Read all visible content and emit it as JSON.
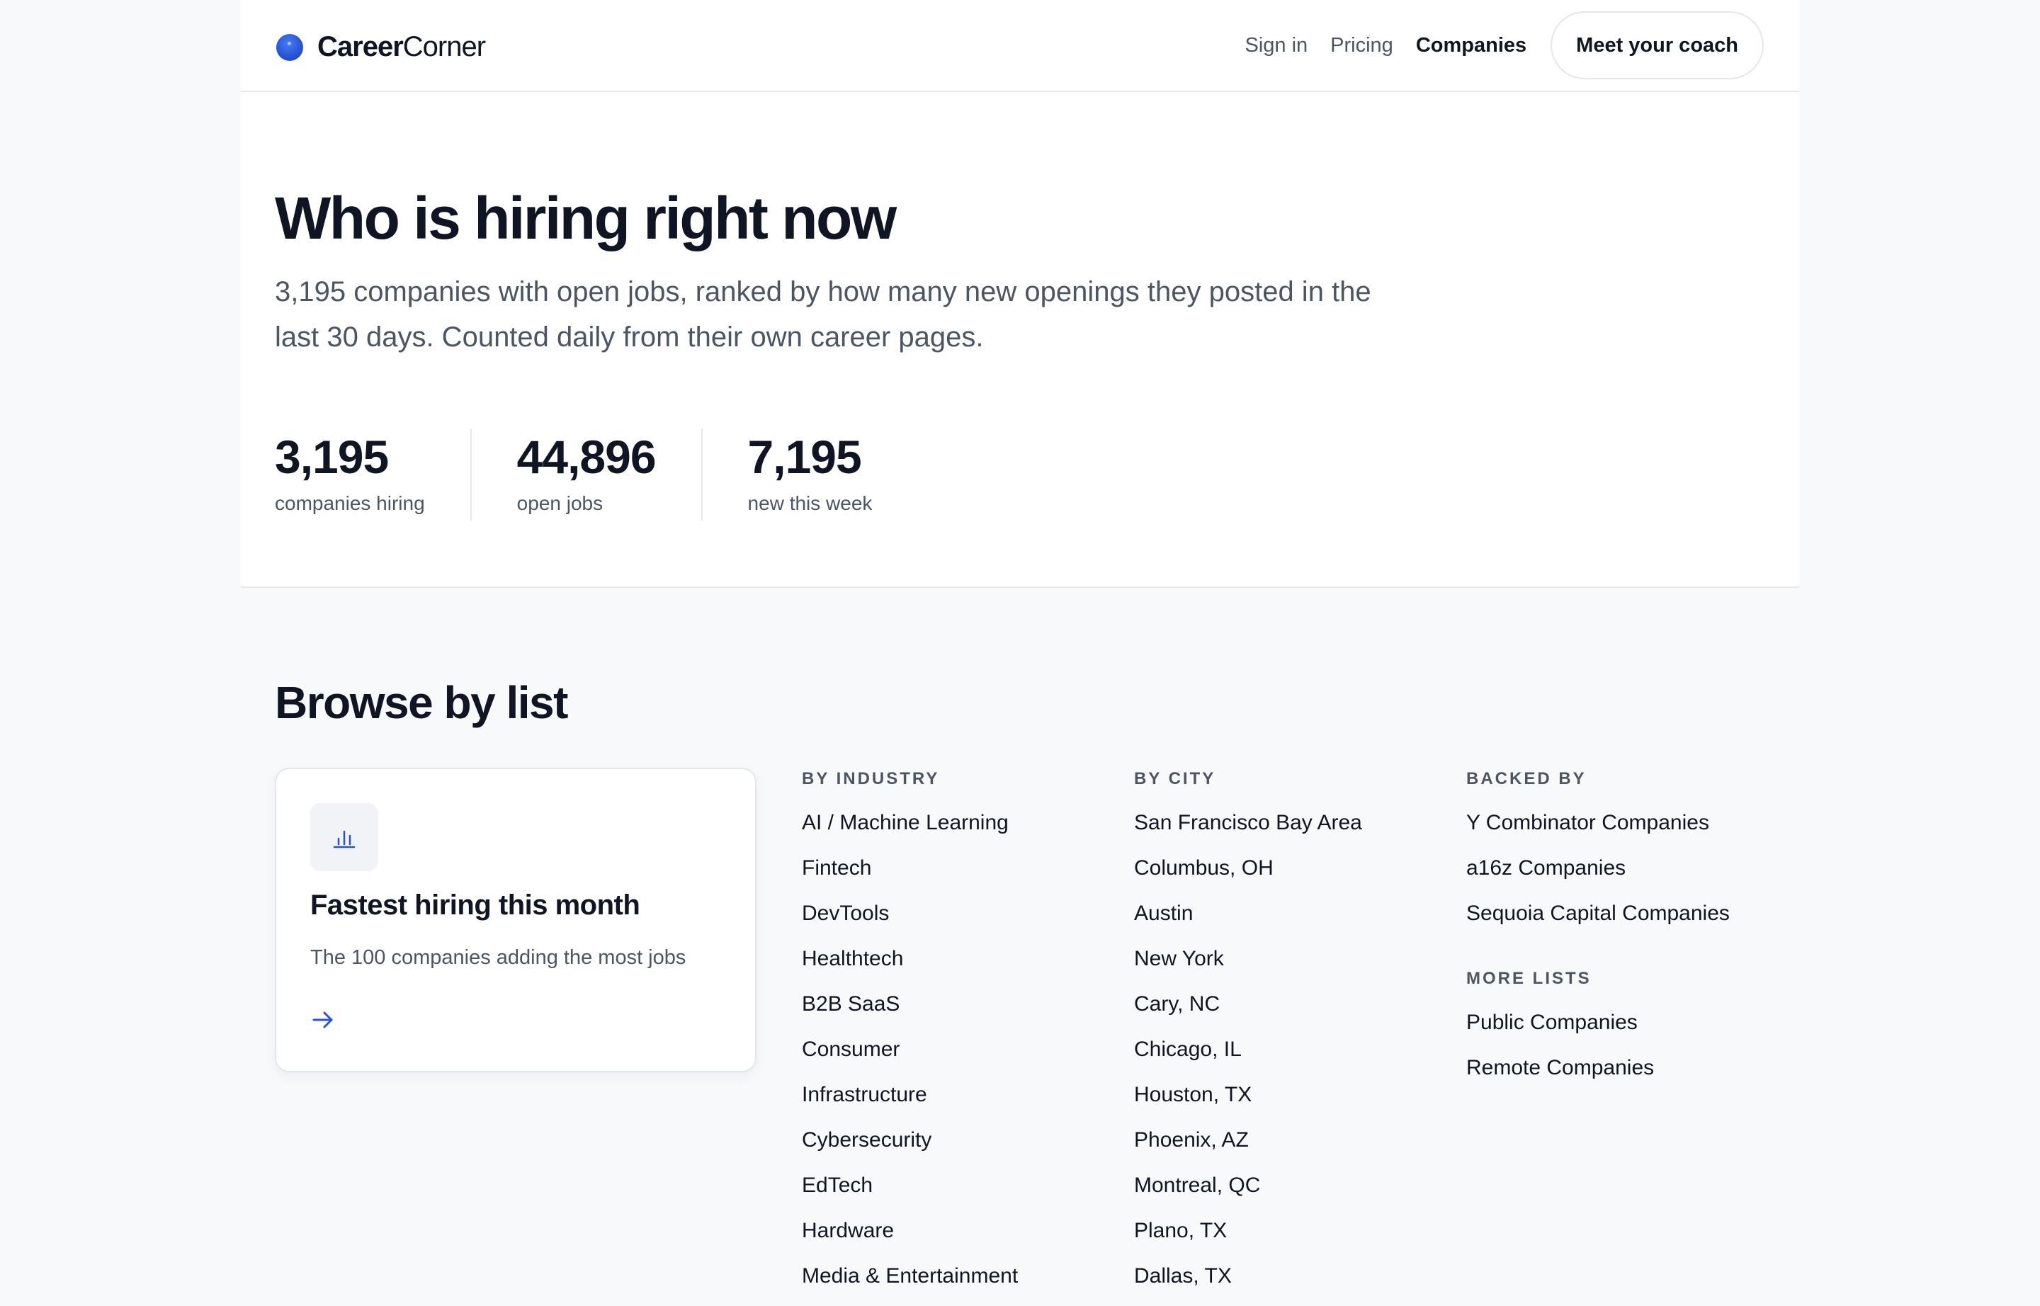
{
  "brand": {
    "name_bold": "Career",
    "name_regular": "Corner"
  },
  "nav": {
    "sign_in": "Sign in",
    "pricing": "Pricing",
    "companies": "Companies",
    "cta": "Meet your coach"
  },
  "hero": {
    "title": "Who is hiring right now",
    "subtitle": "3,195 companies with open jobs, ranked by how many new openings they posted in the last 30 days. Counted daily from their own career pages.",
    "stats": [
      {
        "value": "3,195",
        "label": "companies hiring"
      },
      {
        "value": "44,896",
        "label": "open jobs"
      },
      {
        "value": "7,195",
        "label": "new this week"
      }
    ]
  },
  "browse": {
    "title": "Browse by list",
    "featured": {
      "title": "Fastest hiring this month",
      "description": "The 100 companies adding the most jobs",
      "icon": "bar-chart-icon"
    },
    "by_industry": {
      "heading": "BY INDUSTRY",
      "items": [
        "AI / Machine Learning",
        "Fintech",
        "DevTools",
        "Healthtech",
        "B2B SaaS",
        "Consumer",
        "Infrastructure",
        "Cybersecurity",
        "EdTech",
        "Hardware",
        "Media & Entertainment"
      ]
    },
    "by_city": {
      "heading": "BY CITY",
      "items": [
        "San Francisco Bay Area",
        "Columbus, OH",
        "Austin",
        "New York",
        "Cary, NC",
        "Chicago, IL",
        "Houston, TX",
        "Phoenix, AZ",
        "Montreal, QC",
        "Plano, TX",
        "Dallas, TX"
      ]
    },
    "backed_by": {
      "heading": "BACKED BY",
      "items": [
        "Y Combinator Companies",
        "a16z Companies",
        "Sequoia Capital Companies"
      ]
    },
    "more_lists": {
      "heading": "MORE LISTS",
      "items": [
        "Public Companies",
        "Remote Companies"
      ]
    }
  },
  "colors": {
    "accent": "#2453d6",
    "text": "#0f1522",
    "muted": "#4b5563"
  }
}
